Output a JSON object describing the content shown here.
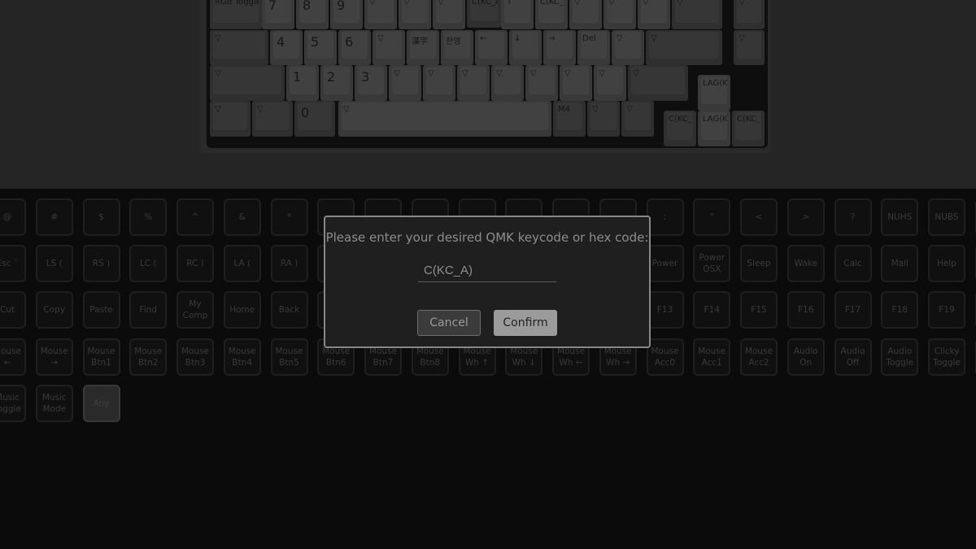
{
  "keyboard_preview": {
    "rows": [
      [
        "RGB Toggle",
        "7",
        "8",
        "9",
        "▽",
        "▽",
        "▽",
        "C(KC_A",
        "↑",
        "C(KC_E",
        "▽",
        "▽",
        "▽",
        "▽",
        "▽"
      ],
      [
        "▽",
        "4",
        "5",
        "6",
        "▽",
        "漢字",
        "한영",
        "←",
        "↓",
        "→",
        "Del",
        "▽",
        "▽",
        "▽"
      ],
      [
        "▽",
        "1",
        "2",
        "3",
        "▽",
        "▽",
        "▽",
        "▽",
        "▽",
        "▽",
        "▽",
        "▽",
        "LAG(K("
      ],
      [
        "▽",
        "▽",
        "0",
        "▽",
        "M4",
        "▽",
        "▽",
        "C(KC_I",
        "LAG(K(",
        "C(KC_F"
      ]
    ]
  },
  "keycode_grid": {
    "rows": [
      [
        "@",
        "#",
        "$",
        "%",
        "^",
        "&",
        "*",
        null,
        null,
        null,
        null,
        null,
        null,
        null,
        ":",
        "\"",
        "<",
        ">",
        "?",
        "NUHS",
        "NUBS"
      ],
      [
        "Esc `",
        "LS (",
        "RS )",
        "LC (",
        "RC )",
        "LA (",
        "RA )",
        null,
        null,
        null,
        null,
        null,
        null,
        null,
        "Power",
        "Power\nOSX",
        "Sleep",
        "Wake",
        "Calc",
        "Mail",
        "Help"
      ],
      [
        "Cut",
        "Copy",
        "Paste",
        "Find",
        "My\nComp",
        "Home",
        "Back",
        null,
        null,
        null,
        null,
        null,
        null,
        null,
        "F13",
        "F14",
        "F15",
        "F16",
        "F17",
        "F18",
        "F19"
      ],
      [
        "Mouse\n←",
        "Mouse\n→",
        "Mouse\nBtn1",
        "Mouse\nBtn2",
        "Mouse\nBtn3",
        "Mouse\nBtn4",
        "Mouse\nBtn5",
        "Mouse\nBtn6",
        "Mouse\nBtn7",
        "Mouse\nBtn8",
        "Mouse\nWh ↑",
        "Mouse\nWh ↓",
        "Mouse\nWh ←",
        "Mouse\nWh →",
        "Mouse\nAcc0",
        "Mouse\nAcc1",
        "Mouse\nAcc2",
        "Audio\nOn",
        "Audio\nOff",
        "Audio\nToggle",
        "Clicky\nToggle"
      ],
      [
        "Music\nToggle",
        "Music\nMode",
        "Any"
      ]
    ],
    "selected": "Any"
  },
  "dialog": {
    "title": "Please enter your desired QMK keycode or hex code:",
    "input_value": "C(KC_A)",
    "cancel_label": "Cancel",
    "confirm_label": "Confirm"
  }
}
